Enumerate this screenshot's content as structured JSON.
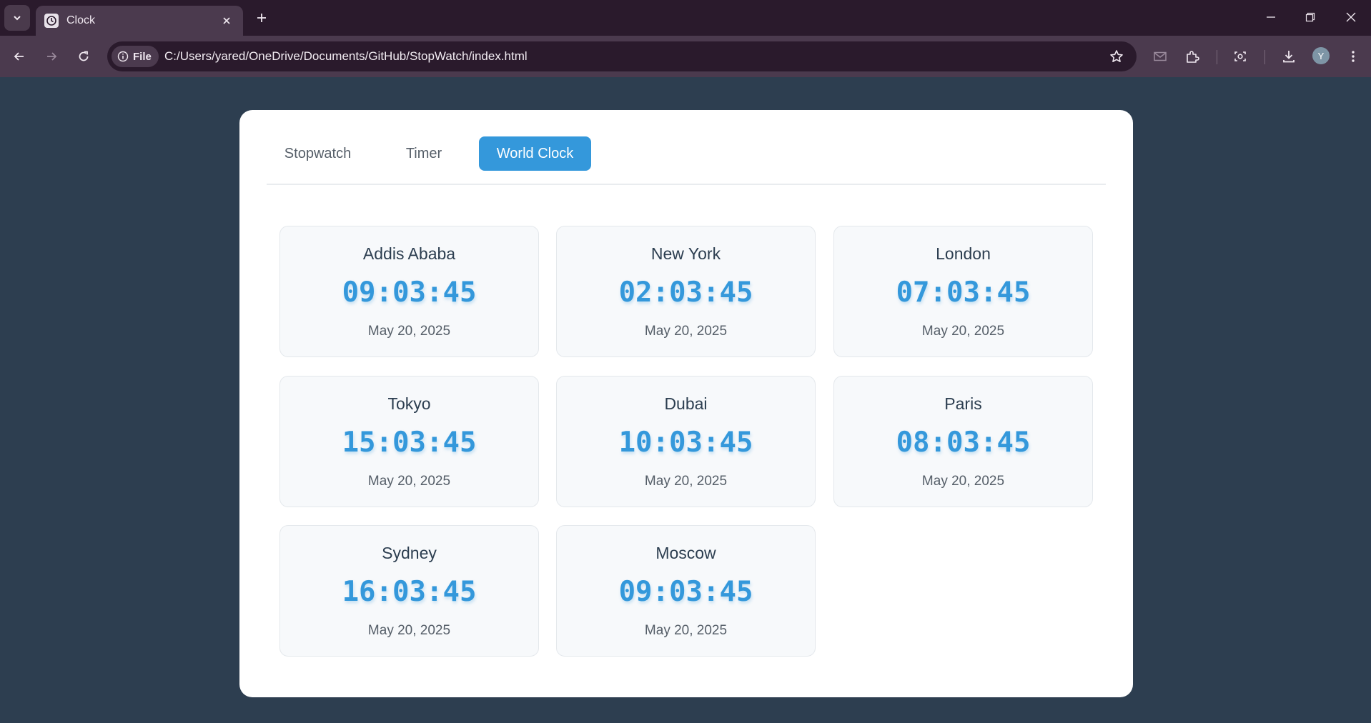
{
  "browser": {
    "tab_title": "Clock",
    "file_chip": "File",
    "url": "C:/Users/yared/OneDrive/Documents/GitHub/StopWatch/index.html",
    "avatar_initial": "Y"
  },
  "app": {
    "mode_tabs": [
      {
        "label": "Stopwatch",
        "active": false
      },
      {
        "label": "Timer",
        "active": false
      },
      {
        "label": "World Clock",
        "active": true
      }
    ],
    "clocks": [
      {
        "city": "Addis Ababa",
        "time": "09:03:45",
        "date": "May 20, 2025"
      },
      {
        "city": "New York",
        "time": "02:03:45",
        "date": "May 20, 2025"
      },
      {
        "city": "London",
        "time": "07:03:45",
        "date": "May 20, 2025"
      },
      {
        "city": "Tokyo",
        "time": "15:03:45",
        "date": "May 20, 2025"
      },
      {
        "city": "Dubai",
        "time": "10:03:45",
        "date": "May 20, 2025"
      },
      {
        "city": "Paris",
        "time": "08:03:45",
        "date": "May 20, 2025"
      },
      {
        "city": "Sydney",
        "time": "16:03:45",
        "date": "May 20, 2025"
      },
      {
        "city": "Moscow",
        "time": "09:03:45",
        "date": "May 20, 2025"
      }
    ]
  },
  "colors": {
    "page_background": "#2d3e50",
    "accent": "#3498db",
    "browser_frame": "#2a1a2c",
    "toolbar": "#4b3a4e"
  }
}
